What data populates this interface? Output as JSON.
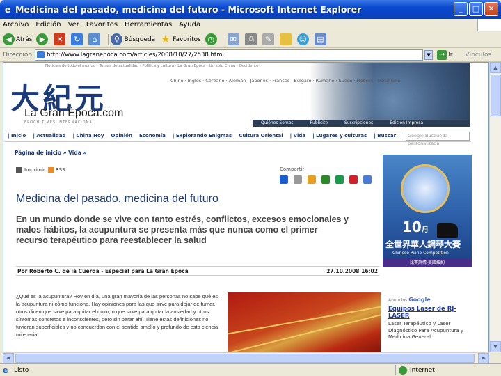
{
  "window": {
    "title": "Medicina del pasado, medicina del futuro - Microsoft Internet Explorer",
    "min": "_",
    "max": "□",
    "close": "✕"
  },
  "menu": [
    "Archivo",
    "Edición",
    "Ver",
    "Favoritos",
    "Herramientas",
    "Ayuda"
  ],
  "toolbar": {
    "back": "Atrás",
    "search": "Búsqueda",
    "favorites": "Favoritos"
  },
  "address": {
    "label": "Dirección",
    "url": "http://www.lagranepoca.com/articles/2008/10/27/2538.html",
    "go": "Ir",
    "links": "Vínculos"
  },
  "site": {
    "top_line": "Noticias de todo el mundo · Temas de actualidad · Política y cultura · La Gran Época · Un solo Chino · Occidente",
    "logo_cn": "大紀元",
    "logo_es": "La Gran Época.com",
    "logo_sub": "EPOCH TIMES INTERNACIONAL",
    "languages": "Chino · Inglés · Coreano · Alemán · Japonés · Francés · Búlgaro · Rumano · Sueco · Hebreo · Ucraniano",
    "darkbar": [
      "Quiénes Somos",
      "Publicite",
      "Suscripciones",
      "Edición Impresa"
    ],
    "nav": [
      "| Inicio",
      "| Actualidad",
      "| China Hoy",
      "Opinión",
      "Economía",
      "| Explorando Enigmas",
      "Cultura Oriental",
      "| Vida",
      "| Lugares y culturas",
      "| Buscar"
    ],
    "gsearch": "Google Búsqueda personalizada"
  },
  "article": {
    "breadcrumb": "Página de inicio » Vida »",
    "print": "Imprimir",
    "rss": "RSS",
    "share_label": "Compartir",
    "headline": "Medicina del pasado, medicina del futuro",
    "lede": "En un mundo donde se vive con tanto estrés, conflictos, excesos emocionales y malos hábitos, la acupuntura se presenta más que nunca como el primer recurso terapéutico para reestablecer la salud",
    "byline": "Por Roberto C. de la Cuerda - Especial para La Gran Época",
    "date": "27.10.2008 16:02",
    "body": "¿Qué es la acupuntura? Hoy en día, una gran mayoría de las personas no sabe qué es la acupuntura ni cómo funciona. Hay opiniones para las que sirve para dejar de fumar, otros dicen que sirve para quitar el dolor, o que sirve para quitar la ansiedad y otros síntomas concretos e inconscientes, pero sin parar ahí. Tiene estas definiciones no tuvieran superficiales y no concuerdan con el sentido amplio y profundo de esta ciencia milenaria."
  },
  "ad": {
    "month": "10",
    "month_unit": "月",
    "cn": "全世界華人鋼琴大賽",
    "en": "Chinese Piano Competition",
    "foot": "比賽詳情·美國紐約"
  },
  "google_ads": {
    "label": "Anuncios",
    "brand": "Google",
    "title": "Equipos Laser de RJ-LASER",
    "desc": "Laser Terapéutico y Laser Diagnóstico Para Acupuntura y Medicina General."
  },
  "status": {
    "text": "Listo",
    "zone": "Internet"
  },
  "colors": {
    "title_bar": "#0a49d0",
    "link_blue": "#1a3a7a",
    "xp_gray": "#ece9d8"
  }
}
